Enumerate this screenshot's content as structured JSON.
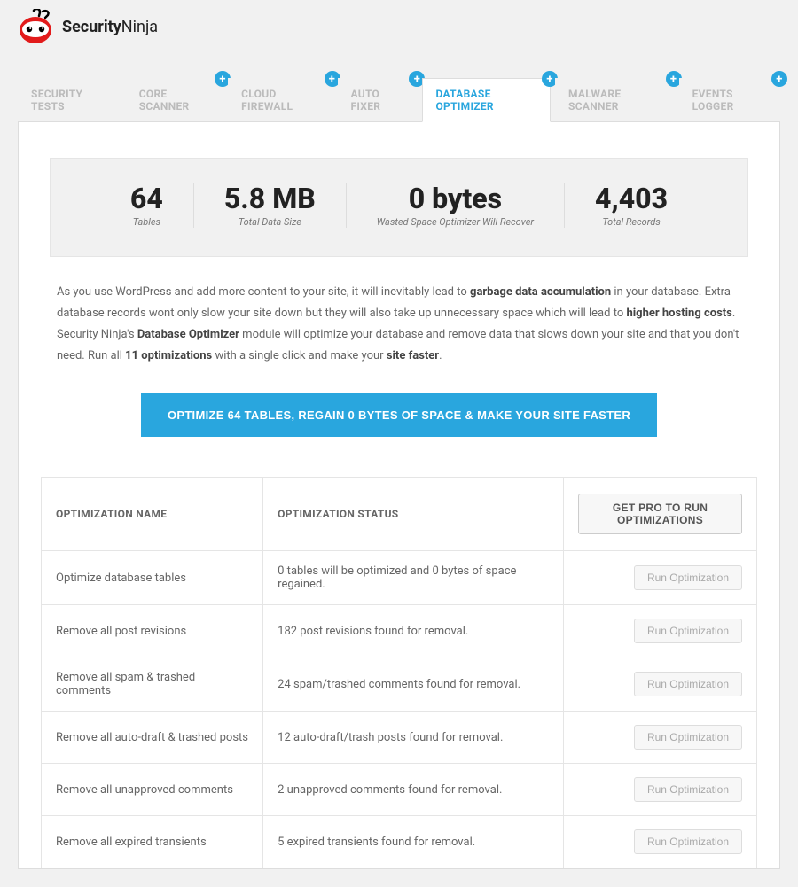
{
  "brand": {
    "name1": "Security",
    "name2": "Ninja"
  },
  "tabs": [
    {
      "label": "SECURITY TESTS",
      "badge": false,
      "active": false
    },
    {
      "label": "CORE SCANNER",
      "badge": true,
      "active": false
    },
    {
      "label": "CLOUD FIREWALL",
      "badge": true,
      "active": false
    },
    {
      "label": "AUTO FIXER",
      "badge": true,
      "active": false
    },
    {
      "label": "DATABASE OPTIMIZER",
      "badge": true,
      "active": true
    },
    {
      "label": "MALWARE SCANNER",
      "badge": true,
      "active": false
    },
    {
      "label": "EVENTS LOGGER",
      "badge": true,
      "active": false
    }
  ],
  "stats": {
    "tables": {
      "value": "64",
      "label": "Tables"
    },
    "size": {
      "value": "5.8 MB",
      "label": "Total Data Size"
    },
    "wasted": {
      "value": "0 bytes",
      "label": "Wasted Space Optimizer Will Recover"
    },
    "records": {
      "value": "4,403",
      "label": "Total Records"
    }
  },
  "description": {
    "t1": "As you use WordPress and add more content to your site, it will inevitably lead to ",
    "b1": "garbage data accumulation",
    "t2": " in your database. Extra database records wont only slow your site down but they will also take up unnecessary space which will lead to ",
    "b2": "higher hosting costs",
    "t3": ". Security Ninja's ",
    "b3": "Database Optimizer",
    "t4": " module will optimize your database and remove data that slows down your site and that you don't need. Run all ",
    "b4": "11 optimizations",
    "t5": " with a single click and make your ",
    "b5": "site faster",
    "t6": "."
  },
  "mainButton": "OPTIMIZE 64 TABLES, REGAIN 0 BYTES OF SPACE & MAKE YOUR SITE FASTER",
  "tableHeaders": {
    "name": "OPTIMIZATION NAME",
    "status": "OPTIMIZATION STATUS",
    "action": "GET PRO TO RUN OPTIMIZATIONS"
  },
  "runLabel": "Run Optimization",
  "rows": [
    {
      "name": "Optimize database tables",
      "status": "0 tables will be optimized and 0 bytes of space regained."
    },
    {
      "name": "Remove all post revisions",
      "status": "182 post revisions found for removal."
    },
    {
      "name": "Remove all spam & trashed comments",
      "status": "24 spam/trashed comments found for removal."
    },
    {
      "name": "Remove all auto-draft & trashed posts",
      "status": "12 auto-draft/trash posts found for removal."
    },
    {
      "name": "Remove all unapproved comments",
      "status": "2 unapproved comments found for removal."
    },
    {
      "name": "Remove all expired transients",
      "status": "5 expired transients found for removal."
    }
  ]
}
